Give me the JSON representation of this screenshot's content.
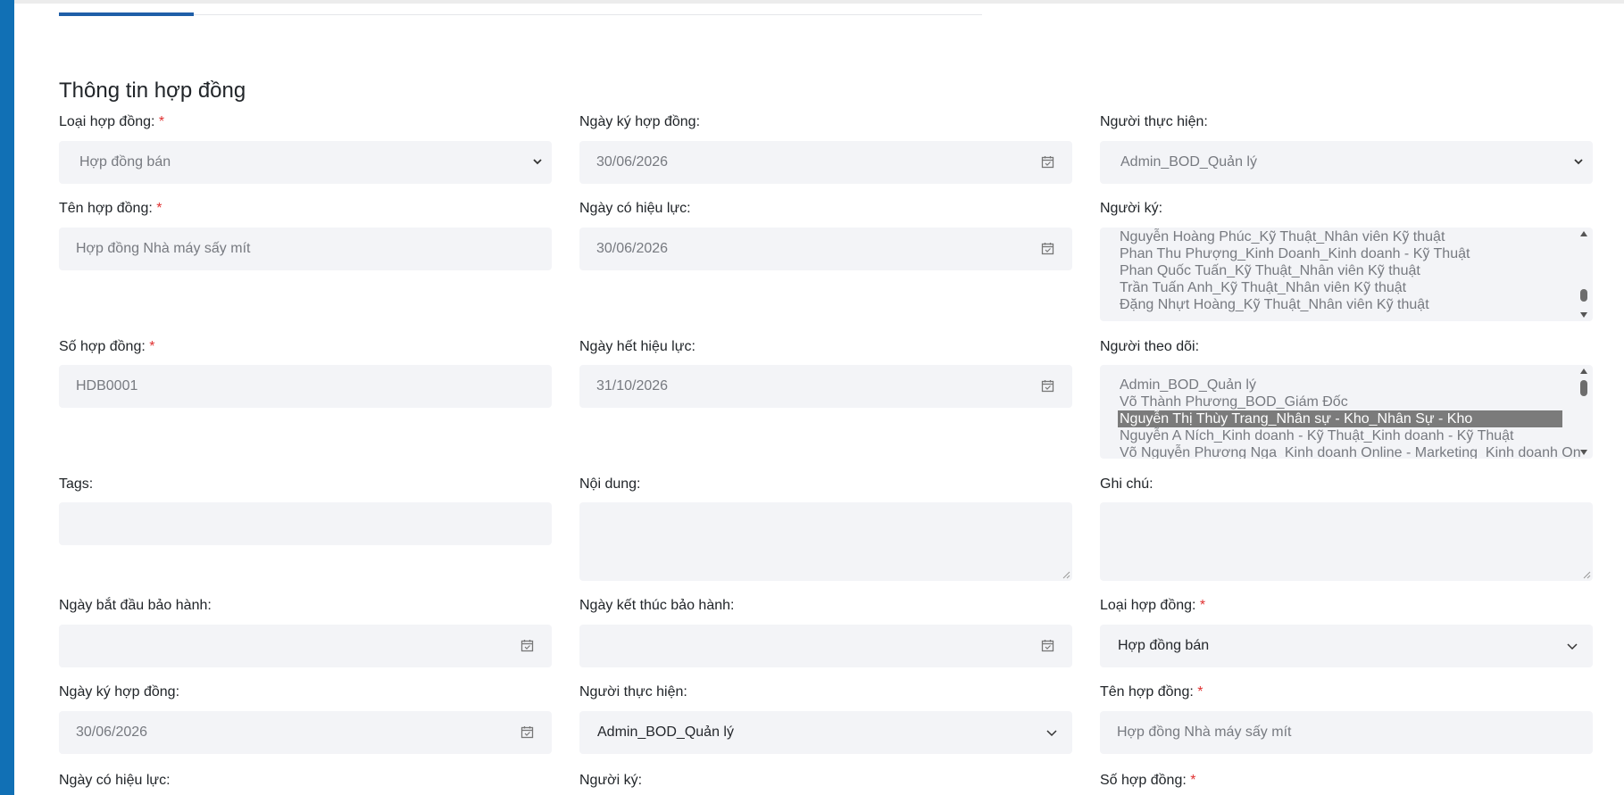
{
  "section": {
    "title": "Thông tin hợp đồng"
  },
  "required_mark": "*",
  "row1": {
    "contract_type": {
      "label": "Loại hợp đồng:",
      "value": "Hợp đồng bán"
    },
    "sign_date": {
      "label": "Ngày ký hợp đồng:",
      "value": "30/06/2026"
    },
    "performer": {
      "label": "Người thực hiện:",
      "value": "Admin_BOD_Quản lý"
    }
  },
  "row2": {
    "contract_name": {
      "label": "Tên hợp đồng:",
      "value": "Hợp đồng Nhà máy sấy mít"
    },
    "effective_date": {
      "label": "Ngày có hiệu lực:",
      "value": "30/06/2026"
    },
    "signer": {
      "label": "Người ký:",
      "options": [
        "Nguyễn Hoàng Phúc_Kỹ Thuật_Nhân viên Kỹ thuật",
        "Phan Thu Phượng_Kinh Doanh_Kinh doanh - Kỹ Thuật",
        "Phan Quốc Tuấn_Kỹ Thuật_Nhân viên Kỹ thuật",
        "Trần Tuấn Anh_Kỹ Thuật_Nhân viên Kỹ thuật",
        "Đặng Nhựt Hoàng_Kỹ Thuật_Nhân viên Kỹ thuật"
      ]
    }
  },
  "row3": {
    "contract_number": {
      "label": "Số hợp đồng:",
      "value": "HDB0001"
    },
    "expiry_date": {
      "label": "Ngày hết hiệu lực:",
      "value": "31/10/2026"
    },
    "followers": {
      "label": "Người theo dõi:",
      "options": [
        "Admin_BOD_Quản lý",
        "Võ Thành Phương_BOD_Giám Đốc",
        "Nguyễn Thị Thùy Trang_Nhân sự - Kho_Nhân Sự - Kho",
        "Nguyễn A Ních_Kinh doanh - Kỹ Thuật_Kinh doanh - Kỹ Thuật",
        "Võ Nguyễn Phương Nga_Kinh doanh Online - Marketing_Kinh doanh Online - Marketing"
      ],
      "selected_index": 2
    }
  },
  "row4": {
    "tags": {
      "label": "Tags:",
      "value": ""
    },
    "content": {
      "label": "Nội dung:",
      "value": ""
    },
    "note": {
      "label": "Ghi chú:",
      "value": ""
    }
  },
  "row5": {
    "warranty_start": {
      "label": "Ngày bắt đầu bảo hành:",
      "value": ""
    },
    "warranty_end": {
      "label": "Ngày kết thúc bảo hành:",
      "value": ""
    },
    "contract_type_2": {
      "label": "Loại hợp đồng:",
      "value": "Hợp đồng bán"
    }
  },
  "row6": {
    "sign_date_2": {
      "label": "Ngày ký hợp đồng:",
      "value": "30/06/2026"
    },
    "performer_2": {
      "label": "Người thực hiện:",
      "value": "Admin_BOD_Quản lý"
    },
    "contract_name_2": {
      "label": "Tên hợp đồng:",
      "value": "Hợp đồng Nhà máy sấy mít"
    }
  },
  "row7": {
    "effective_date_2": {
      "label": "Ngày có hiệu lực:"
    },
    "signer_2": {
      "label": "Người ký:"
    },
    "contract_number_2": {
      "label": "Số hợp đồng:"
    }
  },
  "icons": {
    "calendar": "calendar-icon",
    "chevron": "chevron-down-icon",
    "resize": "resize-handle-icon"
  },
  "colors": {
    "accent": "#1170b5",
    "tab_active": "#1f5fa8",
    "field_bg": "#f3f4f7",
    "required": "#e03131",
    "selected_option_bg": "#7b7b7b"
  }
}
